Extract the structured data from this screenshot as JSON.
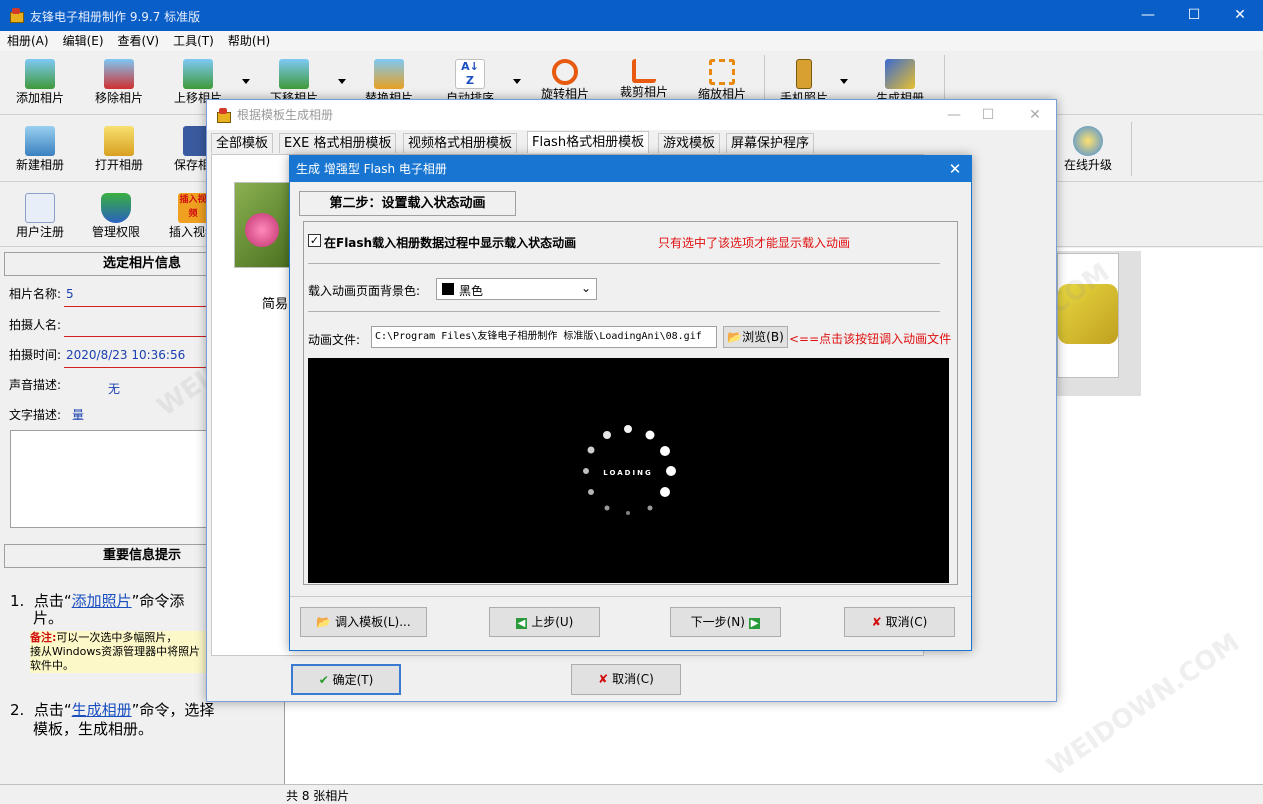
{
  "main_window": {
    "title": "友锋电子相册制作 9.9.7 标准版",
    "controls": {
      "minimize": "—",
      "maximize": "☐",
      "close": "✕"
    }
  },
  "menu": [
    "相册(A)",
    "编辑(E)",
    "查看(V)",
    "工具(T)",
    "帮助(H)"
  ],
  "toolbar1": [
    {
      "label": "添加相片",
      "icon": "add-photo-icon"
    },
    {
      "label": "移除相片",
      "icon": "remove-photo-icon"
    },
    {
      "label": "上移相片",
      "icon": "move-up-photo-icon"
    },
    {
      "label": "下移相片",
      "icon": "move-down-photo-icon"
    },
    {
      "label": "替换相片",
      "icon": "replace-photo-icon"
    },
    {
      "label": "自动排序",
      "icon": "sort-az-icon"
    },
    {
      "label": "旋转相片",
      "icon": "rotate-icon"
    },
    {
      "label": "裁剪相片",
      "icon": "crop-icon"
    },
    {
      "label": "缩放相片",
      "icon": "zoom-icon"
    },
    {
      "label": "手机照片",
      "icon": "phone-icon"
    },
    {
      "label": "生成相册",
      "icon": "generate-album-icon"
    }
  ],
  "toolbar2": [
    {
      "label": "新建相册",
      "icon": "new-album-icon"
    },
    {
      "label": "打开相册",
      "icon": "open-album-icon"
    },
    {
      "label": "保存相册",
      "icon": "save-album-icon"
    },
    {
      "label": "在线升级",
      "icon": "online-upgrade-icon"
    }
  ],
  "toolbar3": [
    {
      "label": "用户注册",
      "icon": "register-icon"
    },
    {
      "label": "管理权限",
      "icon": "permission-shield-icon"
    },
    {
      "label": "插入视频",
      "icon": "insert-video-icon"
    }
  ],
  "insert_video_badge": "插入视频",
  "left_panel": {
    "photo_info_header": "选定相片信息",
    "fields": [
      {
        "label": "相片名称:",
        "value": "5"
      },
      {
        "label": "拍摄人名:",
        "value": ""
      },
      {
        "label": "拍摄时间:",
        "value": "2020/8/23 10:36:56"
      },
      {
        "label": "声音描述:",
        "value": "无"
      },
      {
        "label": "文字描述:",
        "value": "量"
      }
    ],
    "tips_header": "重要信息提示",
    "tip1": {
      "num": "1.",
      "prefix": "点击“",
      "link": "添加照片",
      "suffix": "”命令添",
      "cont": "片。"
    },
    "tip1_note": {
      "bold": "备注:",
      "text": "可以一次选中多幅照片，",
      "line2": "接从Windows资源管理器中将照片",
      "line3": "软件中。"
    },
    "tip2": {
      "num": "2.",
      "prefix": "点击“",
      "link": "生成相册",
      "suffix": "”命令，选择",
      "cont": "模板，生成相册。"
    }
  },
  "status_bar": {
    "text": "共 8 张相片"
  },
  "template_dialog": {
    "title": "根据模板生成相册",
    "tabs": [
      "全部模板",
      "EXE 格式相册模板",
      "视频格式相册模板",
      "Flash格式相册模板",
      "游戏模板",
      "屏幕保护程序"
    ],
    "active_tab": "Flash格式相册模板",
    "preview_caption": "简易",
    "ok_button": "确定(T)",
    "cancel_button": "取消(C)"
  },
  "flash_dialog": {
    "title": "生成 增强型 Flash 电子相册",
    "step_label": "第二步：设置载入状态动画",
    "checkbox_label": "在Flash载入相册数据过程中显示载入状态动画",
    "checkbox_checked": true,
    "hint1": "只有选中了该选项才能显示载入动画",
    "bg_color_label": "载入动画页面背景色:",
    "bg_color_value": "黑色",
    "file_label": "动画文件:",
    "file_value": "C:\\Program Files\\友锋电子相册制作 标准版\\LoadingAni\\08.gif",
    "browse_button": "浏览(B)",
    "hint2": "<==点击该按钮调入动画文件",
    "loading_text": "LOADING",
    "buttons": {
      "load_template": "调入模板(L)...",
      "prev": "上步(U)",
      "next": "下一步(N)",
      "cancel": "取消(C)"
    }
  },
  "colors": {
    "title_blue": "#0a5ec7",
    "dialog_blue": "#1876d2",
    "hint_red": "#e01010",
    "value_blue": "#1a3fb0"
  }
}
